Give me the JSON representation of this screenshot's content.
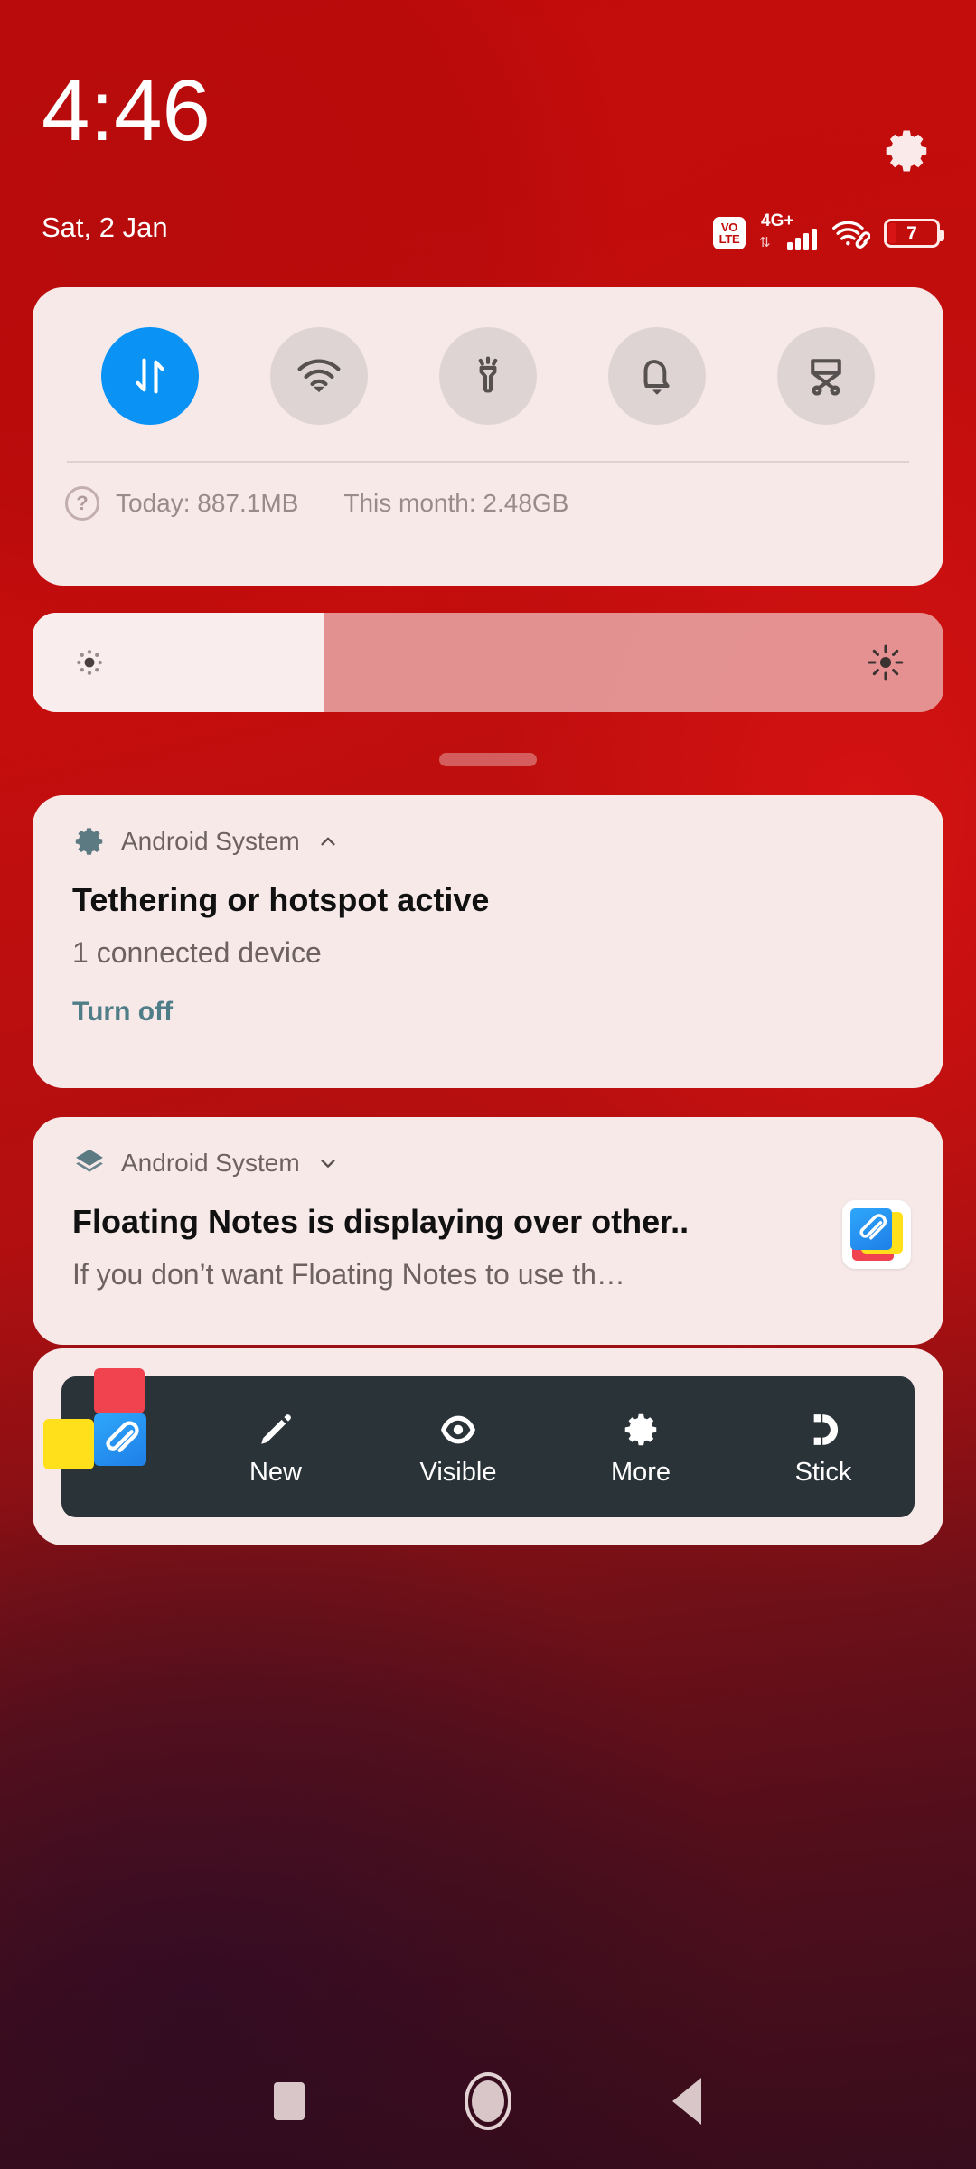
{
  "statusbar": {
    "clock": "4:46",
    "date": "Sat, 2 Jan",
    "volte_top": "VO",
    "volte_bottom": "LTE",
    "network_label": "4G+",
    "battery_level": "7",
    "settings_icon": "gear-icon",
    "wifi_icon": "wifi-hotspot-icon",
    "signal_icon": "signal-bars-icon",
    "battery_icon": "battery-icon"
  },
  "quick_settings": {
    "tiles": [
      {
        "name": "mobile-data",
        "icon": "data-arrows-icon",
        "active": true
      },
      {
        "name": "wifi",
        "icon": "wifi-icon",
        "active": false
      },
      {
        "name": "flashlight",
        "icon": "flashlight-icon",
        "active": false
      },
      {
        "name": "sound",
        "icon": "bell-icon",
        "active": false
      },
      {
        "name": "screenshot",
        "icon": "screenshot-scissors-icon",
        "active": false
      }
    ],
    "help_glyph": "?",
    "usage_today": "Today: 887.1MB",
    "usage_month": "This month: 2.48GB"
  },
  "brightness": {
    "value_percent": 32,
    "low_icon": "brightness-low-icon",
    "high_icon": "brightness-high-icon"
  },
  "notifications": [
    {
      "app": "Android System",
      "icon": "gear-icon",
      "chevron": "chevron-up-icon",
      "title": "Tethering or hotspot active",
      "body": "1 connected device",
      "action": "Turn off"
    },
    {
      "app": "Android System",
      "icon": "layers-icon",
      "chevron": "chevron-down-icon",
      "title": "Floating Notes is displaying over other..",
      "body": "If you don’t want Floating Notes to use th…",
      "app_icon": "floating-notes-app-icon"
    }
  ],
  "widget": {
    "app_icon": "floating-notes-app-icon",
    "actions": [
      {
        "label": "New",
        "icon": "pencil-icon"
      },
      {
        "label": "Visible",
        "icon": "eye-icon"
      },
      {
        "label": "More",
        "icon": "gear-icon"
      },
      {
        "label": "Stick",
        "icon": "magnet-icon"
      }
    ]
  },
  "navbar": {
    "recents": "recents-square-icon",
    "home": "home-circle-icon",
    "back": "back-triangle-icon"
  },
  "colors": {
    "accent_blue": "#0a93f5",
    "card_bg": "#f8e9e9",
    "widget_bg": "#2a3338",
    "action_teal": "#4f7d88",
    "wallpaper_red": "#c20b0b"
  }
}
